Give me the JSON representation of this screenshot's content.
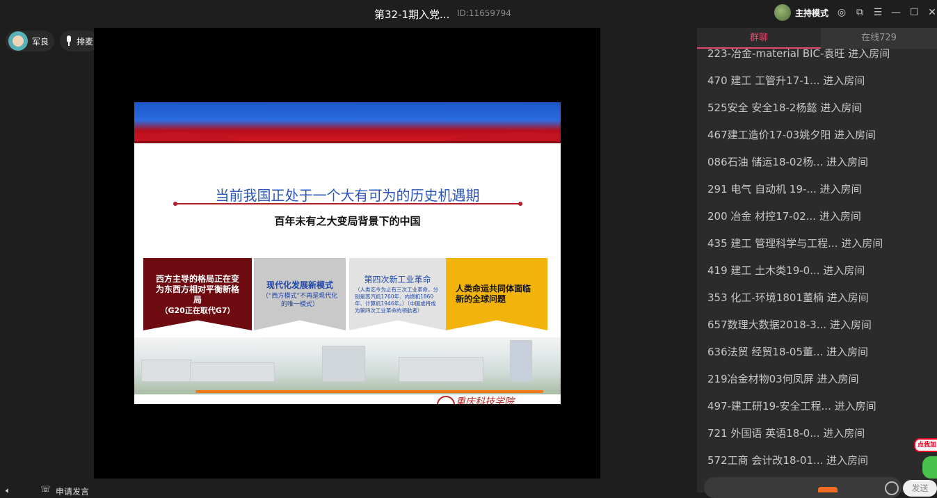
{
  "window": {
    "title": "第32-1期入党...",
    "room_id": "ID:11659794",
    "mode_label": "主持模式",
    "icons": [
      "settings-icon",
      "popout-icon",
      "menu-icon",
      "minimize-icon",
      "maximize-icon",
      "close-icon"
    ]
  },
  "users": [
    {
      "name": "军良",
      "icon": "avatar"
    },
    {
      "name": "排麦",
      "icon": "mic-icon"
    }
  ],
  "slide": {
    "title": "当前我国正处于一个大有可为的历史机遇期",
    "subtitle": "百年未有之大变局背景下的中国",
    "boxes": [
      {
        "heading": "西方主导的格局正在变为东西方相对平衡新格局",
        "sub": "（G20正在取代G7）"
      },
      {
        "heading": "现代化发展新模式",
        "sub": "（“西方模式”不再是现代化的唯一模式）"
      },
      {
        "heading": "第四次新工业革命",
        "sub": "（人类迄今为止有三次工业革命，分别是蒸汽机1760年、内燃机1860年、计算机1946年。）（中国或将成为第四次工业革命的领航者）"
      },
      {
        "heading": "人类命运共同体面临新的全球问题",
        "sub": ""
      }
    ]
  },
  "bottom": {
    "apply_label": "申请发言"
  },
  "panel": {
    "tabs": [
      {
        "label": "群聊"
      },
      {
        "label": "在线729"
      }
    ],
    "messages": [
      "223-冶金-material BIC-袁旺 进入房间",
      "470 建工 工管升17-1... 进入房间",
      "525安全 安全18-2杨懿 进入房间",
      "467建工造价17-03姚夕阳 进入房间",
      "086石油 储运18-02杨... 进入房间",
      "291 电气 自动机 19-... 进入房间",
      "200 冶金 材控17-02... 进入房间",
      "435 建工 管理科学与工程... 进入房间",
      "419 建工 土木类19-0... 进入房间",
      "353 化工-环境1801董楠 进入房间",
      "657数理大数据2018-3... 进入房间",
      "636法贸 经贸18-05董... 进入房间",
      "219冶金材物03何凤屏 进入房间",
      "497-建工研19-安全工程... 进入房间",
      "721 外国语 英语18-0... 进入房间",
      "572工商 会计改18-01... 进入房间"
    ],
    "send_label": "发送",
    "promo_label": "点我加"
  }
}
